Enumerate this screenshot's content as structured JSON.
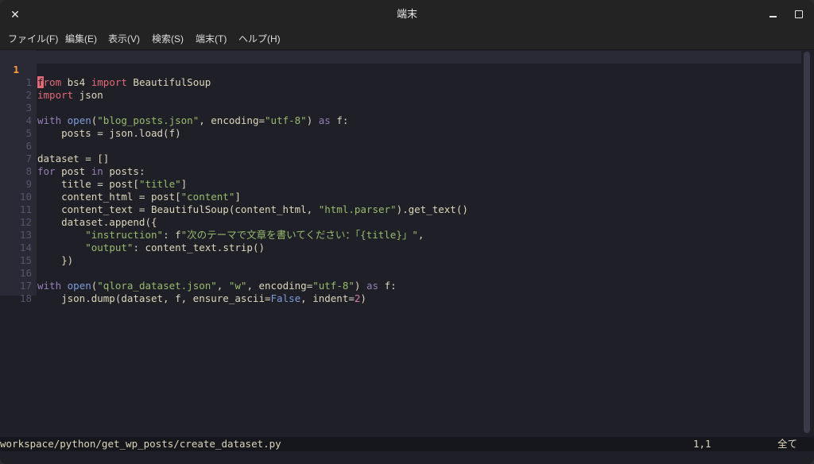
{
  "window": {
    "title": "端末"
  },
  "menu": [
    "ファイル(F)",
    "編集(E)",
    "表示(V)",
    "検索(S)",
    "端末(T)",
    "ヘルプ(H)"
  ],
  "editor": {
    "current_line_number": "1",
    "cursor_char": "f",
    "line_numbers": [
      "1",
      "1",
      "2",
      "3",
      "4",
      "5",
      "6",
      "7",
      "8",
      "9",
      "10",
      "11",
      "12",
      "13",
      "14",
      "15",
      "16",
      "17",
      "18"
    ]
  },
  "status": {
    "file_path": "workspace/python/get_wp_posts/create_dataset.py",
    "position": "1,1",
    "percent": "全て"
  },
  "colors": {
    "background": "#1f1f28",
    "gutter": "#2a2a37",
    "keyword": "#957fb8",
    "import": "#e46876",
    "string": "#98bb6c",
    "function": "#7e9cd8",
    "number": "#d27e99",
    "current_line_number": "#ff9e3b"
  }
}
